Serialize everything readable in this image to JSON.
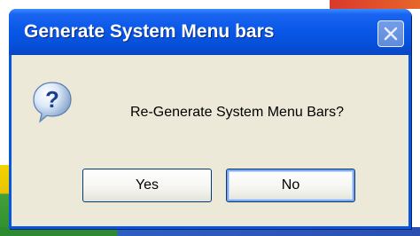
{
  "dialog": {
    "title": "Generate System Menu bars",
    "message": "Re-Generate System Menu Bars?",
    "icon": "question-icon",
    "buttons": {
      "yes_label": "Yes",
      "no_label": "No"
    },
    "default_button": "No"
  },
  "colors": {
    "titlebar": "#0a58e8",
    "dialog_background": "#ece9d8",
    "button_border": "#003c74",
    "focus_ring": "#7fa6ef"
  }
}
